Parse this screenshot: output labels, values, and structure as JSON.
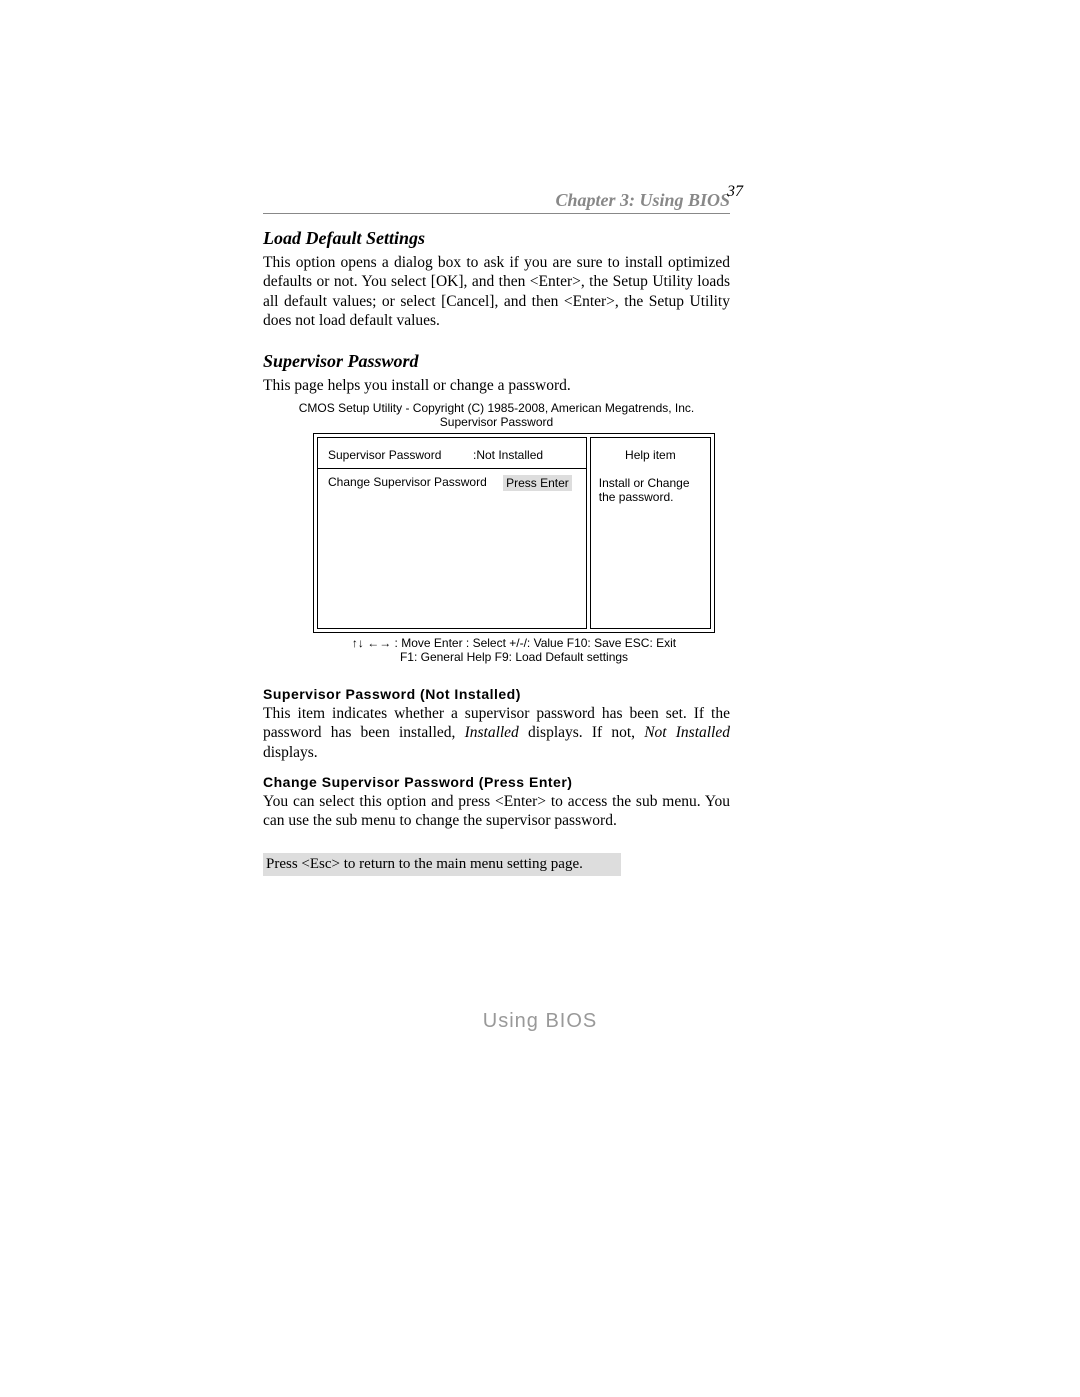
{
  "page_number": "37",
  "chapter_header": "Chapter 3: Using BIOS",
  "sections": {
    "load_default": {
      "title": "Load Default Settings",
      "body": "This option opens a dialog box to ask if you are sure to install optimized defaults or not. You select [OK], and then <Enter>, the Setup Utility loads all default values; or select [Cancel], and then <Enter>, the Setup Utility does not load default values."
    },
    "supervisor_password": {
      "title": "Supervisor Password",
      "intro": "This page helps you install or change a password."
    }
  },
  "bios": {
    "title_line1": "CMOS Setup Utility - Copyright (C) 1985-2008, American Megatrends, Inc.",
    "title_line2": "Supervisor Password",
    "left": {
      "row1_label": "Supervisor Password",
      "row1_value": ":Not Installed",
      "row2_label": "Change Supervisor Password",
      "row2_value": "Press Enter"
    },
    "right": {
      "help_title": "Help item",
      "help_text": "Install or Change the password."
    },
    "legend_line1": "↑↓ ←→   : Move     Enter : Select    +/-/: Value    F10: Save    ESC: Exit",
    "legend_line2": "F1: General Help        F9: Load Default settings"
  },
  "subsections": {
    "sp_not_installed": {
      "heading": "Supervisor Password (Not Installed)",
      "body_pre": "This item indicates whether a supervisor password has been set. If the password has been installed, ",
      "body_italic1": "Installed",
      "body_mid": " displays. If not, ",
      "body_italic2": "Not Installed",
      "body_post": " displays."
    },
    "change_sp": {
      "heading": "Change Supervisor Password (Press Enter)",
      "body": "You can select this option and press <Enter> to access the sub menu. You can use the sub menu to change the supervisor password."
    }
  },
  "esc_note": "Press <Esc> to return to the main menu setting page.",
  "footer": "Using BIOS"
}
